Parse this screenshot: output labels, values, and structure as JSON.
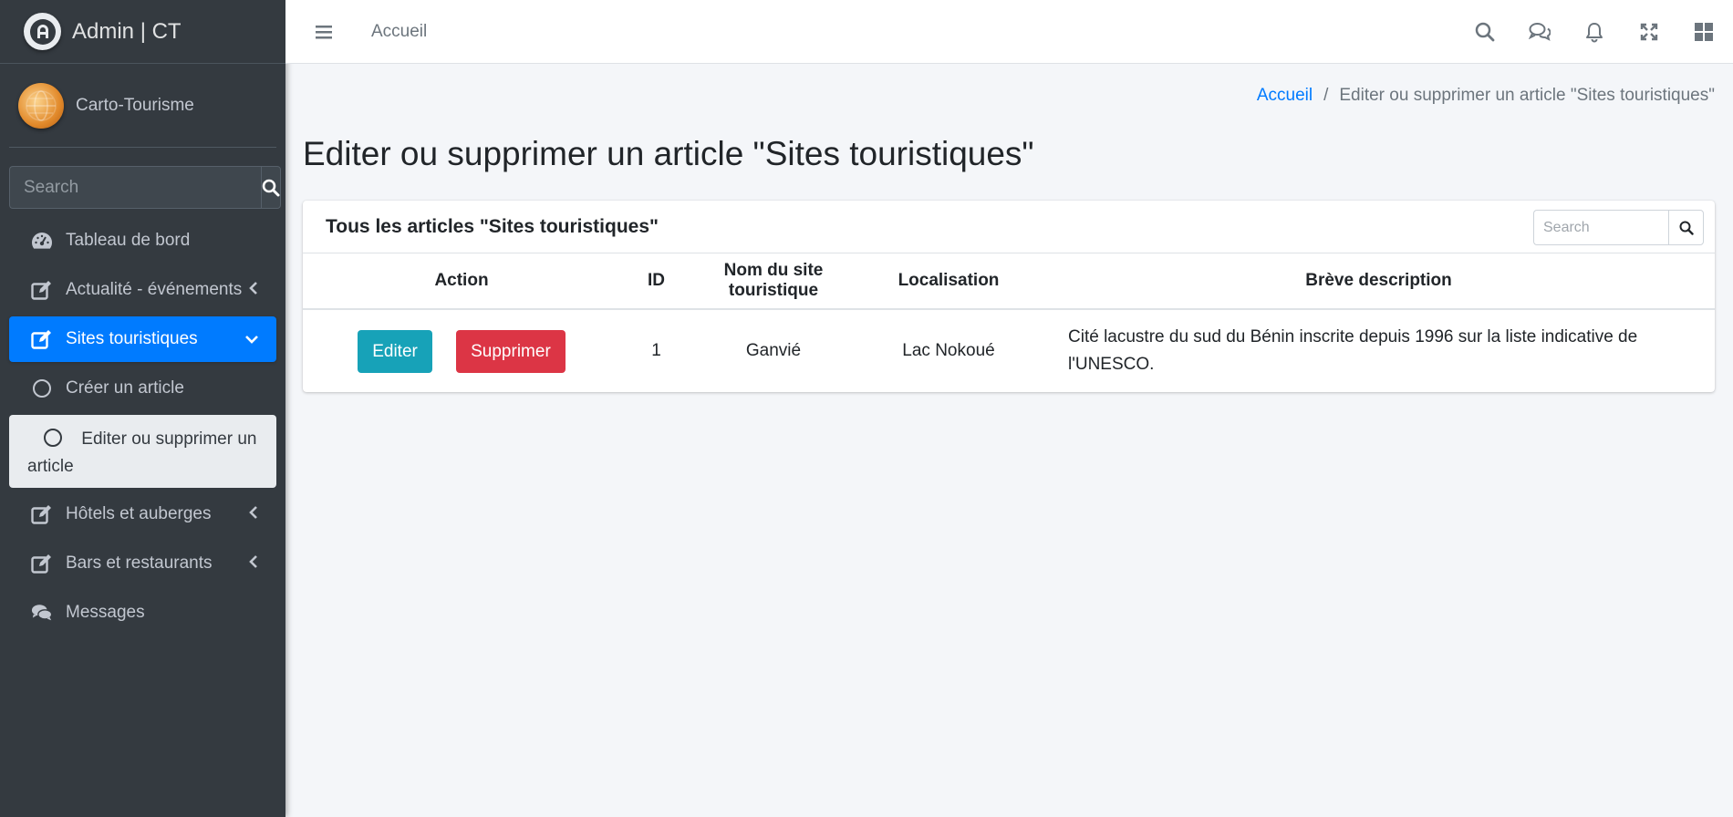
{
  "brand": {
    "name": "Admin | CT"
  },
  "user": {
    "name": "Carto-Tourisme"
  },
  "sidebar_search": {
    "placeholder": "Search"
  },
  "sidebar": {
    "items": [
      {
        "label": "Tableau de bord",
        "icon": "tachometer-icon"
      },
      {
        "label": "Actualité - événements",
        "icon": "edit-icon"
      },
      {
        "label": "Sites touristiques",
        "icon": "edit-icon"
      },
      {
        "label": "Créer un article",
        "icon": "circle-icon"
      },
      {
        "label": "Editer ou supprimer un article",
        "icon": "circle-icon"
      },
      {
        "label": "Hôtels et auberges",
        "icon": "edit-icon"
      },
      {
        "label": "Bars et restaurants",
        "icon": "edit-icon"
      },
      {
        "label": "Messages",
        "icon": "comments-icon"
      }
    ]
  },
  "topbar": {
    "home_link": "Accueil",
    "icons": [
      "search-icon",
      "comments-icon",
      "bell-icon",
      "expand-icon",
      "apps-icon"
    ]
  },
  "breadcrumb": {
    "home": "Accueil",
    "separator": "/",
    "current": "Editer ou supprimer un article \"Sites touristiques\""
  },
  "page": {
    "title": "Editer ou supprimer un article \"Sites touristiques\""
  },
  "card": {
    "title": "Tous les articles \"Sites touristiques\"",
    "search_placeholder": "Search",
    "columns": [
      "Action",
      "ID",
      "Nom du site touristique",
      "Localisation",
      "Brève description"
    ],
    "rows": [
      {
        "edit_label": "Editer",
        "delete_label": "Supprimer",
        "id": "1",
        "name": "Ganvié",
        "location": "Lac Nokoué",
        "description": "Cité lacustre du sud du Bénin inscrite depuis 1996 sur la liste indicative de l'UNESCO."
      }
    ]
  },
  "colors": {
    "sidebar_bg": "#343a40",
    "active_blue": "#007bff",
    "edit_button": "#17a2b8",
    "delete_button": "#dc3545"
  }
}
